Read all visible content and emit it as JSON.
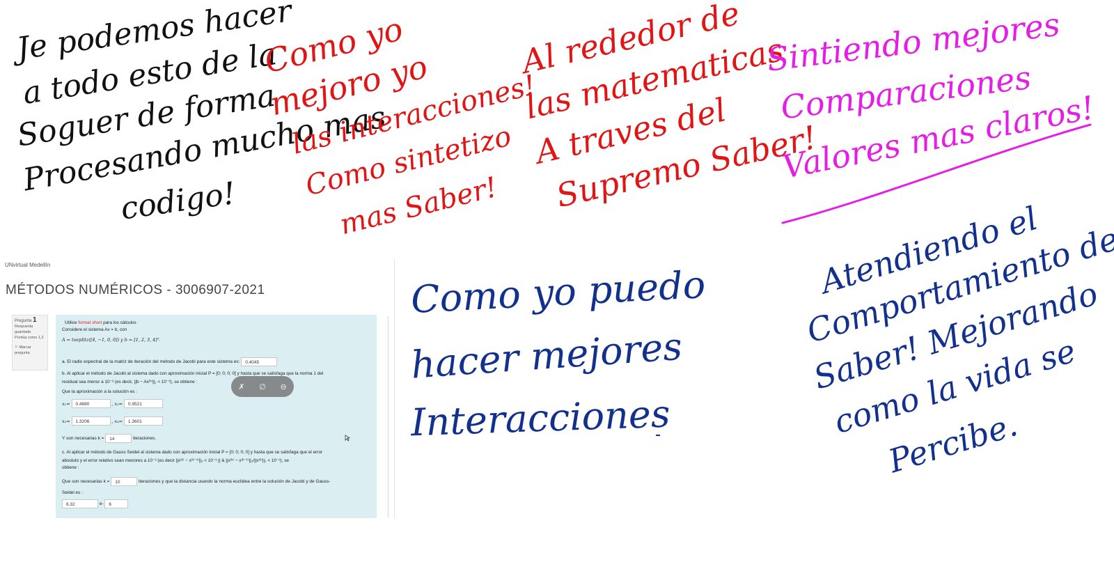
{
  "ink": {
    "black": [
      "Je podemos hacer",
      "a todo esto de la",
      "Soguer de forma",
      "Procesando mucho mas",
      "codigo!"
    ],
    "red_left": [
      "Como yo",
      "mejoro yo",
      "las interacciones!",
      "Como sintetizo",
      "mas Saber!"
    ],
    "red_right": [
      "Al rededor de",
      "las matematicas",
      "A traves del",
      "Supremo Saber!"
    ],
    "magenta": [
      "Sintiendo mejores",
      "Comparaciones",
      "Valores mas claros!"
    ],
    "blue_left": [
      "Como yo puedo",
      "hacer mejores",
      "Interacciones"
    ],
    "blue_right": [
      "Atendiendo el",
      "Comportamiento del",
      "Saber! Mejorando",
      "como la vida se",
      "Percibe."
    ]
  },
  "colors": {
    "black_ink": "#111111",
    "red_ink": "#e01515",
    "magenta_ink": "#e41ee4",
    "blue_ink": "#12318c",
    "question_bg": "#dbeef2"
  },
  "lms": {
    "site": "UNvirtual Medellín",
    "course_title": "MÉTODOS NUMÉRICOS - 3006907-2021",
    "question_info": {
      "label": "Pregunta",
      "number": "1",
      "status": "Respuesta guardada",
      "score": "Puntúa como 1,2",
      "flag": "Marcar pregunta"
    },
    "intro": {
      "pre": "Utilice",
      "fmt": "format short",
      "post": "para los cálculos",
      "line2": "Considere el sistema Ax = b, con",
      "line3": "A = toeplitz([4,   −1,   0,   0]) y b = [1, 2, 3, 4]ᵀ."
    },
    "part_a": {
      "text": "a. El radio espectral de la matriz de iteración del método de Jacobi para este sistema es:",
      "value": "0.4045"
    },
    "part_b": {
      "line1": "b. Al aplicar el método de Jacobi al sistema dado con aproximación inicial P = [0; 0; 0; 0] y hasta que se satisfaga que la norma 1 del",
      "line2": "residual sea menor a 10⁻³ (es decir, ||b − Ax⁽ᵏ⁾||₁ < 10⁻³), se obtiene :",
      "line3": "Que la aproximación a la solución es :",
      "x1_label": "x₁=",
      "x1": "0.4880",
      "x2_label": ", x₂=",
      "x2": "0.9521",
      "x3_label": "x₃=",
      "x3": "1.3206",
      "x4_label": ", x₄=",
      "x4": "1.3601",
      "iter_pre": "Y son necesarias k =",
      "iter": "14",
      "iter_post": "iteraciones."
    },
    "part_c": {
      "line1": "c. Al aplicar el método de Gauss Seidel al sistema dado con aproximación inicial P = [0; 0; 0; 0] y hasta que se satisfaga que el error",
      "line2": "absoluto y el error relativo sean menores a 10⁻³ (es decir ||x⁽ᵏ⁾ − x⁽ᵏ⁻¹⁾||₂ < 10⁻³ || & ||x⁽ᵏ⁾ − x⁽ᵏ⁻¹⁾||₂/||x⁽ᵏ⁾||₂ < 10⁻³), se",
      "line3": "obtiene :",
      "iter_pre": "Que son necesarias k =",
      "iter": "10",
      "iter_post": "iteraciones y que la distancia usando la norma euclidea entre la solución de Jacobi y de Gauss-",
      "line5": "Seidel es :",
      "mantissa": "6.32",
      "exp_label": "e-",
      "exponent": "6"
    }
  }
}
